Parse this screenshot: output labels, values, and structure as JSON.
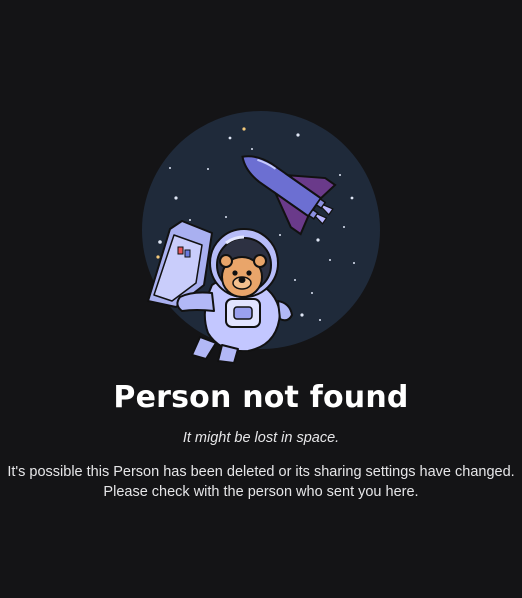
{
  "error_page": {
    "illustration": "astronaut-in-space-illustration",
    "title": "Person not found",
    "subtitle": "It might be lost in space.",
    "description_line_1": "It's possible this Person has been deleted or its sharing settings have changed.",
    "description_line_2": "Please check with the person who sent you here."
  },
  "colors": {
    "background": "#141416",
    "space_circle": "#1f2a3a",
    "text": "#ffffff"
  }
}
